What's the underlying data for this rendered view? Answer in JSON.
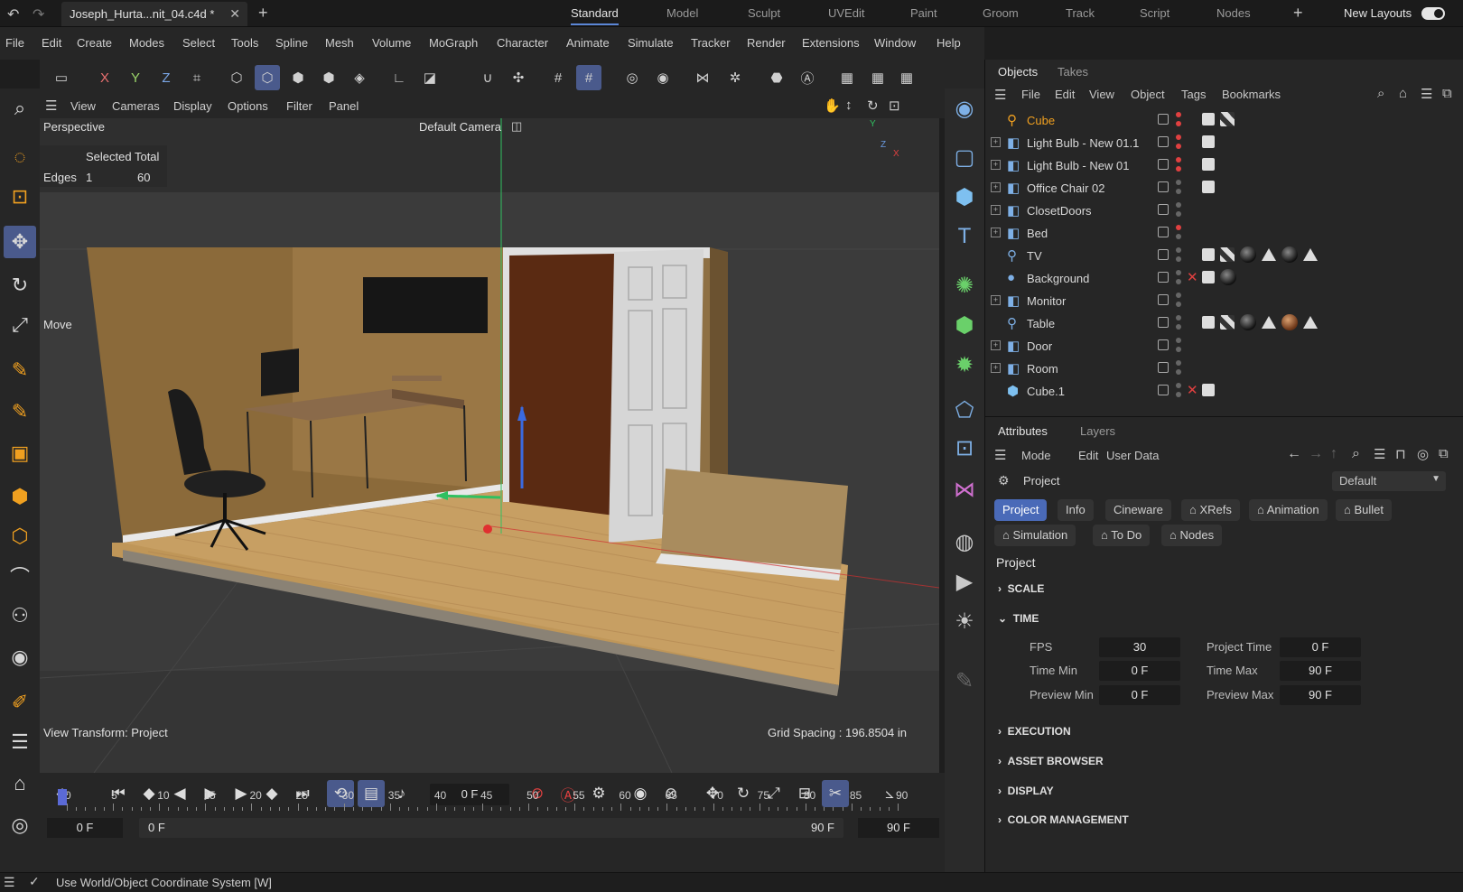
{
  "document_tab": "Joseph_Hurta...nit_04.c4d *",
  "layout_tabs": [
    "Standard",
    "Model",
    "Sculpt",
    "UVEdit",
    "Paint",
    "Groom",
    "Track",
    "Script",
    "Nodes"
  ],
  "new_layouts_label": "New Layouts",
  "menu": [
    "File",
    "Edit",
    "Create",
    "Modes",
    "Select",
    "Tools",
    "Spline",
    "Mesh",
    "Volume",
    "MoGraph",
    "Character",
    "Animate",
    "Simulate",
    "Tracker",
    "Render",
    "Extensions",
    "Window",
    "Help"
  ],
  "viewport": {
    "menu": [
      "View",
      "Cameras",
      "Display",
      "Options",
      "Filter",
      "Panel"
    ],
    "name": "Perspective",
    "camera": "Default Camera",
    "selected_header": "Selected Total",
    "edges_label": "Edges",
    "edges_selected": "1",
    "edges_total": "60",
    "tool_label": "Move",
    "view_transform": "View Transform: Project",
    "grid_spacing": "Grid Spacing : 196.8504 in",
    "axis_labels": {
      "x": "X",
      "y": "Y",
      "z": "Z"
    }
  },
  "objects_panel": {
    "tabs": [
      "Objects",
      "Takes"
    ],
    "menu": [
      "File",
      "Edit",
      "View",
      "Object",
      "Tags",
      "Bookmarks"
    ],
    "items": [
      {
        "name": "Cube",
        "highlight": true
      },
      {
        "name": "Light Bulb - New 01.1"
      },
      {
        "name": "Light Bulb - New 01"
      },
      {
        "name": "Office Chair 02"
      },
      {
        "name": "ClosetDoors"
      },
      {
        "name": "Bed"
      },
      {
        "name": "TV"
      },
      {
        "name": "Background"
      },
      {
        "name": "Monitor"
      },
      {
        "name": "Table"
      },
      {
        "name": "Door"
      },
      {
        "name": "Room"
      },
      {
        "name": "Cube.1"
      }
    ]
  },
  "attributes_panel": {
    "tabs": [
      "Attributes",
      "Layers"
    ],
    "menu": [
      "Mode",
      "Edit",
      "User Data"
    ],
    "object_label": "Project",
    "preset": "Default",
    "pills_row1": [
      "Project",
      "Info",
      "Cineware",
      "XRefs",
      "Animation",
      "Bullet"
    ],
    "pills_row2": [
      "Simulation",
      "To Do",
      "Nodes"
    ],
    "section_title": "Project",
    "sections": {
      "scale": "SCALE",
      "time": "TIME",
      "execution": "EXECUTION",
      "asset_browser": "ASSET BROWSER",
      "display": "DISPLAY",
      "color_management": "COLOR MANAGEMENT"
    },
    "time_fields": {
      "fps_label": "FPS",
      "fps": "30",
      "project_time_label": "Project Time",
      "project_time": "0 F",
      "time_min_label": "Time Min",
      "time_min": "0 F",
      "time_max_label": "Time Max",
      "time_max": "90 F",
      "preview_min_label": "Preview Min",
      "preview_min": "0 F",
      "preview_max_label": "Preview Max",
      "preview_max": "90 F"
    }
  },
  "timeline": {
    "current_frame": "0 F",
    "ticks": [
      "0",
      "5",
      "10",
      "15",
      "20",
      "25",
      "30",
      "35",
      "40",
      "45",
      "50",
      "55",
      "60",
      "65",
      "70",
      "75",
      "80",
      "85",
      "90"
    ],
    "range_start": "0 F",
    "range_start_inner": "0 F",
    "range_end_inner": "90 F",
    "range_end": "90 F"
  },
  "status_text": "Use World/Object Coordinate System [W]"
}
